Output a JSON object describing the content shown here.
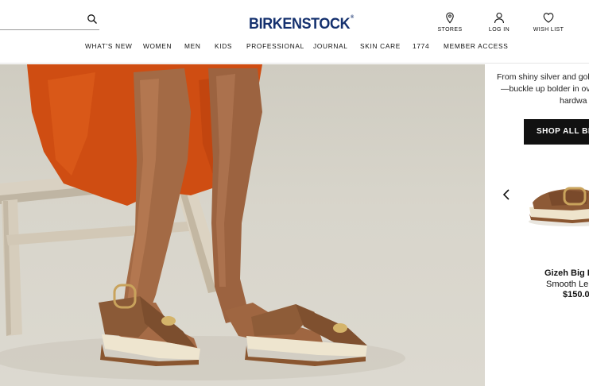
{
  "header": {
    "search": {
      "value": "",
      "placeholder": ""
    },
    "logo": {
      "text": "BIRKENSTOCK",
      "registered": "®"
    },
    "utility": [
      {
        "label": "STORES",
        "icon": "location-pin-icon"
      },
      {
        "label": "LOG IN",
        "icon": "user-icon"
      },
      {
        "label": "WISH LIST",
        "icon": "heart-icon"
      }
    ]
  },
  "nav": {
    "items": [
      {
        "label": "WHAT'S NEW"
      },
      {
        "label": "WOMEN"
      },
      {
        "label": "MEN"
      },
      {
        "label": "KIDS"
      },
      {
        "label": "PROFESSIONAL"
      },
      {
        "label": "JOURNAL"
      },
      {
        "label": "SKIN CARE"
      },
      {
        "label": "1774"
      },
      {
        "label": "MEMBER ACCESS"
      }
    ]
  },
  "hero": {
    "colors": {
      "background": "#d6d3c9",
      "dress": "#d24f12",
      "sandal": "#8a5a38",
      "sole": "#eee6d2"
    }
  },
  "panel": {
    "promo_lines": [
      "From shiny silver and gol",
      "—buckle up bolder in ov",
      "hardwa"
    ],
    "cta_label": "SHOP ALL BIG",
    "carousel_prev_icon": "chevron-left-icon",
    "product": {
      "name": "Gizeh Big I",
      "material": "Smooth Le",
      "price": "$150.0"
    }
  },
  "colors": {
    "brand": "#14306e",
    "text": "#111111",
    "button_bg": "#111111"
  }
}
